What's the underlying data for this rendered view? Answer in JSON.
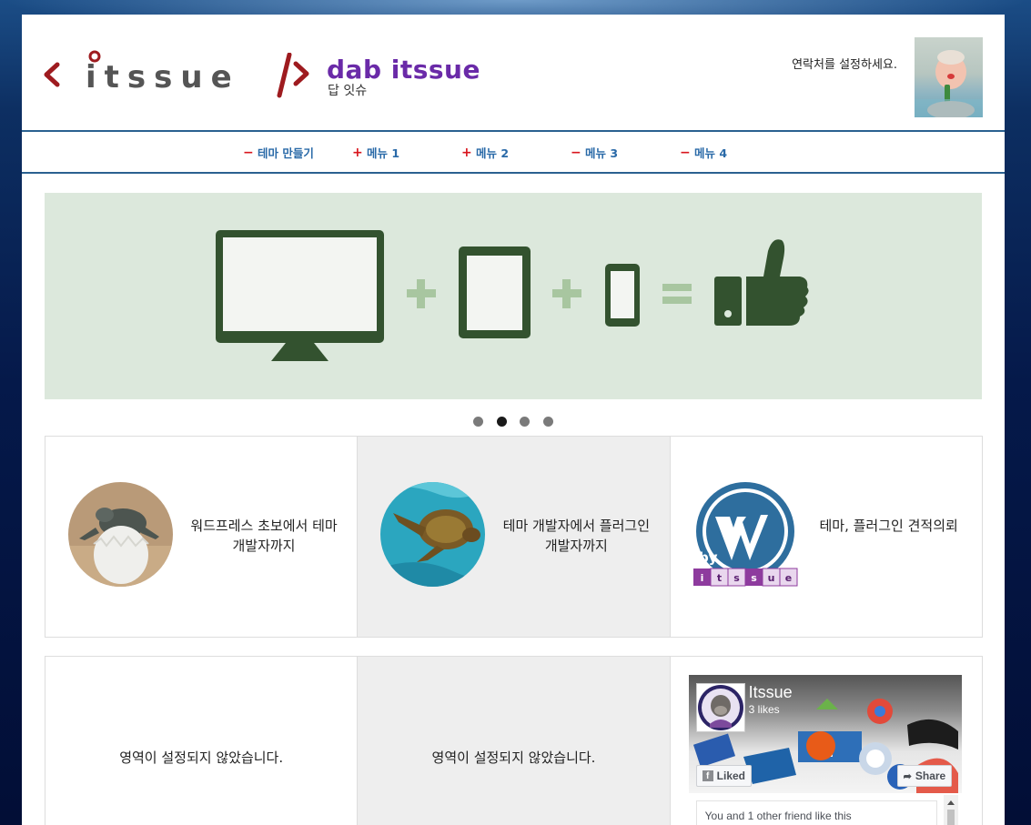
{
  "header": {
    "logo_text": "itssue",
    "site_title": "dab itssue",
    "site_subtitle": "답 잇슈",
    "contact": "연락처를 설정하세요."
  },
  "nav": {
    "items": [
      {
        "label": "테마 만들기",
        "mark": "−"
      },
      {
        "label": "메뉴 1",
        "mark": "+"
      },
      {
        "label": "메뉴 2",
        "mark": "+"
      },
      {
        "label": "메뉴 3",
        "mark": "−"
      },
      {
        "label": "메뉴 4",
        "mark": "−"
      }
    ]
  },
  "slider": {
    "slide_count": 4,
    "active_index": 1,
    "colors": {
      "bg": "#dce8dc",
      "dark": "#33522f",
      "light": "#a8c6a0"
    }
  },
  "features": [
    {
      "text": "워드프레스 초보에서 테마 개발자까지",
      "icon": "hatching-turtle-icon"
    },
    {
      "text": "테마 개발자에서 플러그인 개발자까지",
      "icon": "sea-turtle-icon"
    },
    {
      "text": "테마, 플러그인 견적의뢰",
      "icon": "wordpress-itssue-icon",
      "badge": [
        "i",
        "t",
        "s",
        "s",
        "u",
        "e"
      ],
      "badge_by": "by"
    }
  ],
  "widgets": [
    {
      "text": "영역이 설정되지 않았습니다."
    },
    {
      "text": "영역이 설정되지 않았습니다."
    }
  ],
  "facebook": {
    "page_name": "Itssue",
    "likes": "3 likes",
    "liked_button": "Liked",
    "share_button": "Share",
    "friends_text": "You and 1 other friend like this"
  },
  "colors": {
    "accent_purple": "#6a2aa8",
    "nav_blue": "#2a6aa8",
    "nav_red": "#d8141c",
    "logo_red": "#9e1b1f"
  }
}
